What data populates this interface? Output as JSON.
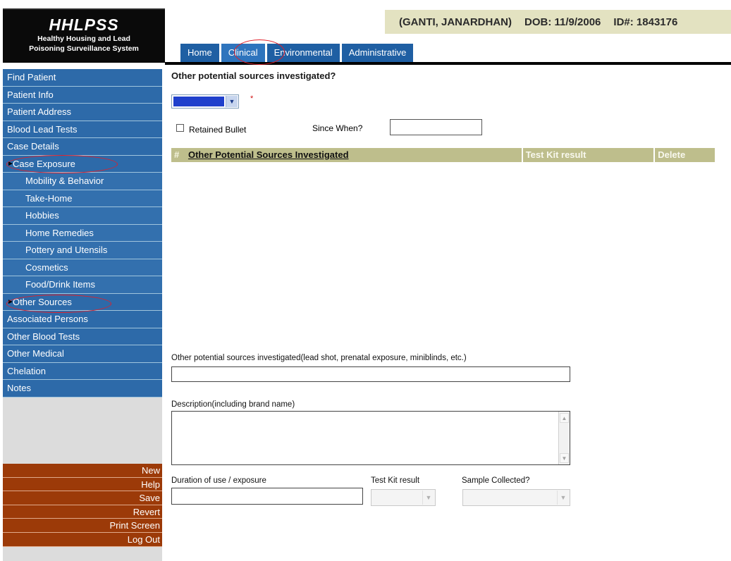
{
  "logo": {
    "name": "HHLPSS",
    "line1": "Healthy Housing and Lead",
    "line2": "Poisoning Surveillance System"
  },
  "patient": {
    "name": "(GANTI, JANARDHAN)",
    "dob": "DOB: 11/9/2006",
    "id": "ID#: 1843176"
  },
  "tabs": [
    {
      "label": "Home"
    },
    {
      "label": "Clinical",
      "active": true
    },
    {
      "label": "Environmental"
    },
    {
      "label": "Administrative"
    }
  ],
  "sidebar": {
    "items": [
      {
        "label": "Find Patient"
      },
      {
        "label": "Patient Info"
      },
      {
        "label": "Patient Address"
      },
      {
        "label": "Blood Lead Tests"
      },
      {
        "label": "Case Details"
      },
      {
        "label": "Case Exposure",
        "marked": true
      },
      {
        "label": "Mobility & Behavior",
        "sub": true
      },
      {
        "label": "Take-Home",
        "sub": true
      },
      {
        "label": "Hobbies",
        "sub": true
      },
      {
        "label": "Home Remedies",
        "sub": true
      },
      {
        "label": "Pottery and Utensils",
        "sub": true
      },
      {
        "label": "Cosmetics",
        "sub": true
      },
      {
        "label": "Food/Drink Items",
        "sub": true
      },
      {
        "label": "Other Sources",
        "marked": true,
        "selected": true
      },
      {
        "label": "Associated Persons"
      },
      {
        "label": "Other Blood Tests"
      },
      {
        "label": "Other Medical"
      },
      {
        "label": "Chelation"
      },
      {
        "label": "Notes"
      }
    ],
    "actions": [
      {
        "label": "New"
      },
      {
        "label": "Help"
      },
      {
        "label": "Save"
      },
      {
        "label": "Revert"
      },
      {
        "label": "Print Screen"
      },
      {
        "label": "Log Out"
      }
    ]
  },
  "main": {
    "title": "Other potential sources investigated?",
    "required_marker": "*",
    "retained_bullet_label": "Retained Bullet",
    "since_when_label": "Since When?",
    "since_when_value": "",
    "table": {
      "columns": [
        "#",
        "Other Potential Sources Investigated",
        "Test Kit result",
        "Delete"
      ]
    },
    "other_sources_label": "Other potential sources investigated(lead shot, prenatal exposure, miniblinds, etc.)",
    "other_sources_value": "",
    "description_label": "Description(including brand name)",
    "description_value": "",
    "duration_label": "Duration of use / exposure",
    "duration_value": "",
    "test_kit_label": "Test Kit result",
    "sample_collected_label": "Sample Collected?"
  },
  "colors": {
    "nav_blue": "#2d6aa9",
    "action_brown": "#9c3a08",
    "header_khaki": "#bebe8c",
    "banner_beige": "#e3e2c1",
    "annotation_red": "#e0202a"
  },
  "icons": {
    "dropdown": "chevron-down-icon",
    "nav_marker": "triangle-right-icon",
    "scroll_up": "scroll-up-icon",
    "scroll_down": "scroll-down-icon"
  }
}
